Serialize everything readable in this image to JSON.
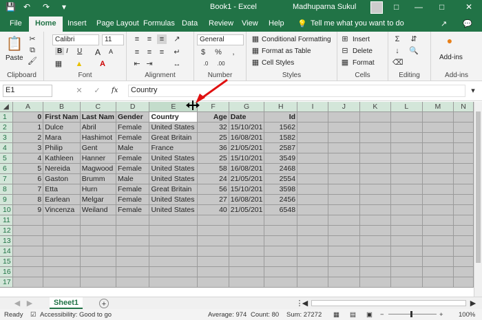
{
  "titlebar": {
    "title": "Book1  -  Excel",
    "user": "Madhuparna Sukul",
    "autosave_icon": "save-icon",
    "undo_icon": "undo-icon",
    "redo_icon": "redo-icon"
  },
  "tabs": [
    "File",
    "Home",
    "Insert",
    "Page Layout",
    "Formulas",
    "Data",
    "Review",
    "View",
    "Help"
  ],
  "active_tab": "Home",
  "tell_me": "Tell me what you want to do",
  "ribbon": {
    "clipboard": {
      "paste": "Paste",
      "label": "Clipboard"
    },
    "font": {
      "name": "Calibri",
      "size": "11",
      "bold": "B",
      "italic": "I",
      "underline": "U",
      "label": "Font",
      "grow": "A",
      "shrink": "A"
    },
    "alignment": {
      "label": "Alignment"
    },
    "number": {
      "format": "General",
      "label": "Number"
    },
    "styles": {
      "cond": "Conditional Formatting",
      "table": "Format as Table",
      "cell": "Cell Styles",
      "label": "Styles"
    },
    "cells": {
      "insert": "Insert",
      "delete": "Delete",
      "format": "Format",
      "label": "Cells"
    },
    "editing": {
      "label": "Editing"
    },
    "addins": {
      "btn": "Add-ins",
      "label": "Add-ins"
    }
  },
  "formula_bar": {
    "namebox": "E1",
    "fx": "fx",
    "value": "Country"
  },
  "columns": [
    "A",
    "B",
    "C",
    "D",
    "E",
    "F",
    "G",
    "H",
    "I",
    "J",
    "K",
    "L",
    "M",
    "N"
  ],
  "rows": [
    [
      "0",
      "First Nam",
      "Last Nam",
      "Gender",
      "Country",
      "Age",
      "Date",
      "Id"
    ],
    [
      "1",
      "Dulce",
      "Abril",
      "Female",
      "United States",
      "32",
      "15/10/201",
      "1562"
    ],
    [
      "2",
      "Mara",
      "Hashimot",
      "Female",
      "Great Britain",
      "25",
      "16/08/201",
      "1582"
    ],
    [
      "3",
      "Philip",
      "Gent",
      "Male",
      "France",
      "36",
      "21/05/201",
      "2587"
    ],
    [
      "4",
      "Kathleen",
      "Hanner",
      "Female",
      "United States",
      "25",
      "15/10/201",
      "3549"
    ],
    [
      "5",
      "Nereida",
      "Magwood",
      "Female",
      "United States",
      "58",
      "16/08/201",
      "2468"
    ],
    [
      "6",
      "Gaston",
      "Brumm",
      "Male",
      "United States",
      "24",
      "21/05/201",
      "2554"
    ],
    [
      "7",
      "Etta",
      "Hurn",
      "Female",
      "Great Britain",
      "56",
      "15/10/201",
      "3598"
    ],
    [
      "8",
      "Earlean",
      "Melgar",
      "Female",
      "United States",
      "27",
      "16/08/201",
      "2456"
    ],
    [
      "9",
      "Vincenza",
      "Weiland",
      "Female",
      "United States",
      "40",
      "21/05/201",
      "6548"
    ]
  ],
  "row_numbers": [
    "1",
    "2",
    "3",
    "4",
    "5",
    "6",
    "7",
    "8",
    "9",
    "10",
    "11",
    "12",
    "13",
    "14",
    "15",
    "16",
    "17"
  ],
  "sheet_tab": "Sheet1",
  "status": {
    "ready": "Ready",
    "accessibility": "Accessibility: Good to go",
    "average": "Average: 974",
    "count": "Count: 80",
    "sum": "Sum: 27272",
    "zoom": "100%"
  }
}
